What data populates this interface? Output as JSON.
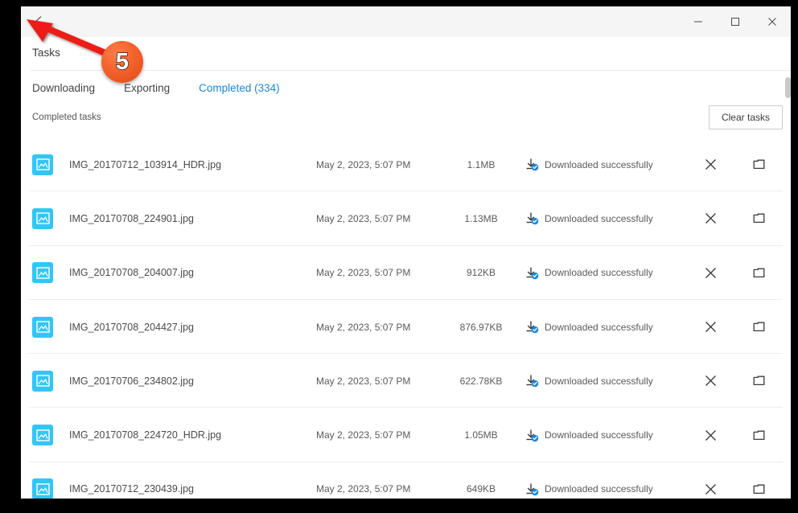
{
  "window": {
    "back_icon": "chevron-left-icon",
    "minimize_label": "—",
    "maximize_label": "□",
    "close_label": "✕"
  },
  "header": {
    "title": "Tasks"
  },
  "tabs": [
    {
      "label": "Downloading",
      "active": false
    },
    {
      "label": "Exporting",
      "active": false
    },
    {
      "label": "Completed (334)",
      "active": true
    }
  ],
  "subheader": {
    "label": "Completed tasks",
    "clear_button": "Clear tasks"
  },
  "colors": {
    "accent_blue": "#1a87e0",
    "file_icon_cyan": "#31c6f7",
    "badge_orange": "#f4622c",
    "status_check_blue": "#1a87e0",
    "titlebar_bg": "#f5f5f5",
    "row_divider": "#eeeeee"
  },
  "tasks": [
    {
      "icon": "image-file-icon",
      "name": "IMG_20170712_103914_HDR.jpg",
      "date": "May 2, 2023, 5:07 PM",
      "size": "1.1MB",
      "status": "Downloaded successfully",
      "status_icon": "download-complete-icon",
      "remove_icon": "close-icon",
      "folder_icon": "folder-icon"
    },
    {
      "icon": "image-file-icon",
      "name": "IMG_20170708_224901.jpg",
      "date": "May 2, 2023, 5:07 PM",
      "size": "1.13MB",
      "status": "Downloaded successfully",
      "status_icon": "download-complete-icon",
      "remove_icon": "close-icon",
      "folder_icon": "folder-icon"
    },
    {
      "icon": "image-file-icon",
      "name": "IMG_20170708_204007.jpg",
      "date": "May 2, 2023, 5:07 PM",
      "size": "912KB",
      "status": "Downloaded successfully",
      "status_icon": "download-complete-icon",
      "remove_icon": "close-icon",
      "folder_icon": "folder-icon"
    },
    {
      "icon": "image-file-icon",
      "name": "IMG_20170708_204427.jpg",
      "date": "May 2, 2023, 5:07 PM",
      "size": "876.97KB",
      "status": "Downloaded successfully",
      "status_icon": "download-complete-icon",
      "remove_icon": "close-icon",
      "folder_icon": "folder-icon"
    },
    {
      "icon": "image-file-icon",
      "name": "IMG_20170706_234802.jpg",
      "date": "May 2, 2023, 5:07 PM",
      "size": "622.78KB",
      "status": "Downloaded successfully",
      "status_icon": "download-complete-icon",
      "remove_icon": "close-icon",
      "folder_icon": "folder-icon"
    },
    {
      "icon": "image-file-icon",
      "name": "IMG_20170708_224720_HDR.jpg",
      "date": "May 2, 2023, 5:07 PM",
      "size": "1.05MB",
      "status": "Downloaded successfully",
      "status_icon": "download-complete-icon",
      "remove_icon": "close-icon",
      "folder_icon": "folder-icon"
    },
    {
      "icon": "image-file-icon",
      "name": "IMG_20170712_230439.jpg",
      "date": "May 2, 2023, 5:07 PM",
      "size": "649KB",
      "status": "Downloaded successfully",
      "status_icon": "download-complete-icon",
      "remove_icon": "close-icon",
      "folder_icon": "folder-icon"
    }
  ],
  "annotation": {
    "step_number": "5",
    "arrow_target": "back-button"
  }
}
